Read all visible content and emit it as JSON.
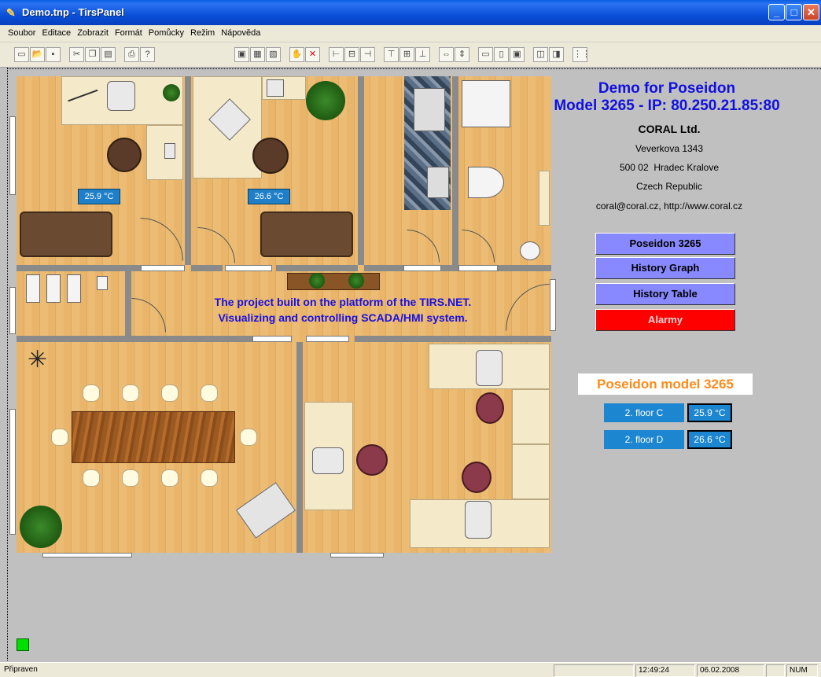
{
  "window": {
    "title": "Demo.tnp - TirsPanel"
  },
  "menu": [
    "Soubor",
    "Editace",
    "Zobrazit",
    "Formát",
    "Pomůcky",
    "Režim",
    "Nápověda"
  ],
  "plan": {
    "temp_room_c": "25.9 °C",
    "temp_room_d": "26.6 °C",
    "caption_line1": "The project built on the platform of the TIRS.NET.",
    "caption_line2": "Visualizing and controlling SCADA/HMI system."
  },
  "info": {
    "title1": "Demo for Poseidon",
    "title2": "Model 3265 - IP: 80.250.21.85:80",
    "company": "CORAL Ltd.",
    "street": "Veverkova 1343",
    "city": "500 02  Hradec Kralove",
    "country": "Czech Republic",
    "contact": "coral@coral.cz, http://www.coral.cz"
  },
  "nav": {
    "poseidon": "Poseidon 3265",
    "history_graph": "History Graph",
    "history_table": "History Table",
    "alarm": "Alarmy"
  },
  "sensors": {
    "heading": "Poseidon model 3265",
    "rows": [
      {
        "label": "2. floor C",
        "value": "25.9 °C"
      },
      {
        "label": "2. floor D",
        "value": "26.6 °C"
      }
    ]
  },
  "status": {
    "text": "Připraven",
    "time": "12:49:24",
    "date": "06.02.2008",
    "num": "NUM"
  },
  "colors": {
    "nav_button": "#8888ff",
    "alarm": "#ff0000",
    "title_text": "#1010e0",
    "sensor_box": "#1c86d0"
  }
}
